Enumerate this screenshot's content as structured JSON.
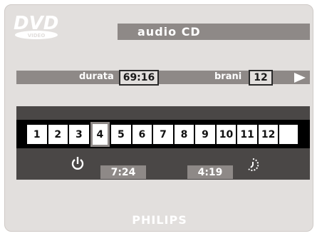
{
  "logo": {
    "text": "DVD",
    "subtext": "VIDEO",
    "icon": "dvd-video-logo"
  },
  "title": "audio CD",
  "info": {
    "duration_label": "durata",
    "duration_value": "69:16",
    "tracks_label": "brani",
    "tracks_value": "12",
    "play_icon": "play-arrow-icon"
  },
  "tracks": [
    "1",
    "2",
    "3",
    "4",
    "5",
    "6",
    "7",
    "8",
    "9",
    "10",
    "11",
    "12",
    ""
  ],
  "selected_track": "4",
  "elapsed": {
    "icon": "power-icon",
    "value": "7:24"
  },
  "remaining": {
    "icon": "clock-icon",
    "value": "4:19"
  },
  "brand": "PHILIPS",
  "colors": {
    "panel": "#e2dfdd",
    "bar": "#8e8987",
    "track_area": "#4a4746",
    "strip": "#000000"
  }
}
